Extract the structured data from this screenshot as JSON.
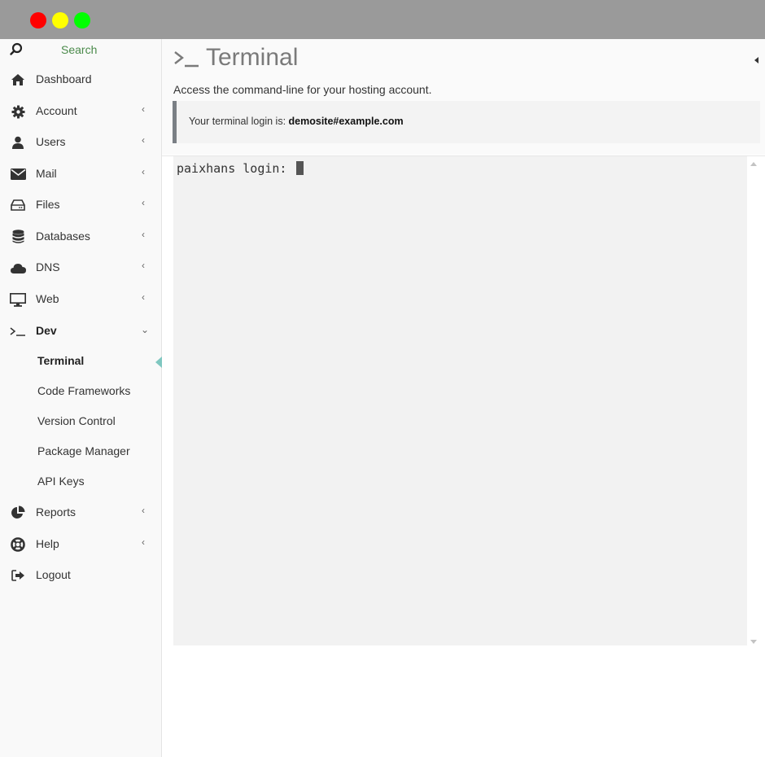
{
  "window": {
    "controls": [
      "close",
      "minimize",
      "maximize"
    ],
    "control_colors": {
      "close": "#ff0000",
      "minimize": "#ffff00",
      "maximize": "#00ff00"
    }
  },
  "sidebar": {
    "search_label": "Search",
    "items": [
      {
        "label": "Dashboard",
        "icon": "home-icon",
        "has_chevron": false
      },
      {
        "label": "Account",
        "icon": "gear-icon",
        "has_chevron": true
      },
      {
        "label": "Users",
        "icon": "user-icon",
        "has_chevron": true
      },
      {
        "label": "Mail",
        "icon": "envelope-icon",
        "has_chevron": true
      },
      {
        "label": "Files",
        "icon": "drive-icon",
        "has_chevron": true
      },
      {
        "label": "Databases",
        "icon": "database-icon",
        "has_chevron": true
      },
      {
        "label": "DNS",
        "icon": "cloud-icon",
        "has_chevron": true
      },
      {
        "label": "Web",
        "icon": "monitor-icon",
        "has_chevron": true
      },
      {
        "label": "Dev",
        "icon": "terminal-prompt-icon",
        "has_chevron": true,
        "expanded": true
      },
      {
        "label": "Reports",
        "icon": "pie-chart-icon",
        "has_chevron": true
      },
      {
        "label": "Help",
        "icon": "lifebuoy-icon",
        "has_chevron": true
      },
      {
        "label": "Logout",
        "icon": "sign-out-icon",
        "has_chevron": false
      }
    ],
    "dev_subitems": [
      {
        "label": "Terminal",
        "active": true
      },
      {
        "label": "Code Frameworks",
        "active": false
      },
      {
        "label": "Version Control",
        "active": false
      },
      {
        "label": "Package Manager",
        "active": false
      },
      {
        "label": "API Keys",
        "active": false
      }
    ],
    "accent_color": "#7fc7c0"
  },
  "page": {
    "title": "Terminal",
    "description": "Access the command-line for your hosting account.",
    "callout_prefix": "Your terminal login is: ",
    "terminal_login": "demosite#example.com"
  },
  "terminal": {
    "prompt": "paixhans login: "
  }
}
